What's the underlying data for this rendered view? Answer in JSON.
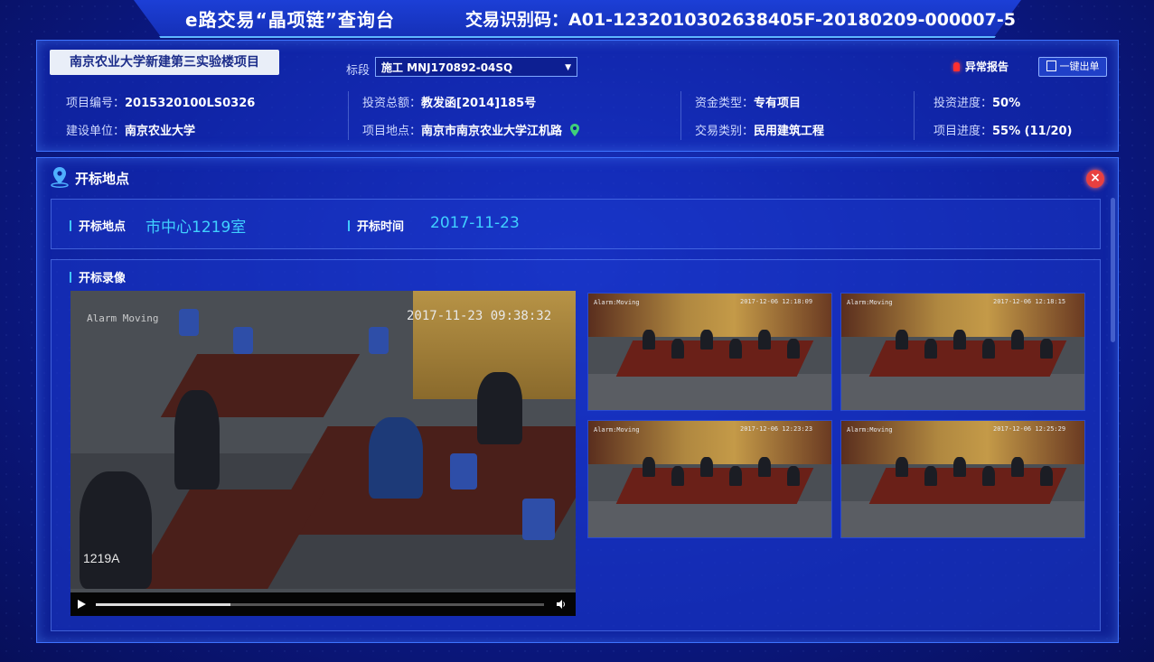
{
  "header": {
    "app_title": "e路交易“晶项链”查询台",
    "transaction_code_label": "交易识别码：",
    "transaction_code": "A01-1232010302638405F-20180209-000007-5"
  },
  "project": {
    "name": "南京农业大学新建第三实验楼项目",
    "section_label": "标段",
    "section_value": "施工 MNJ170892-04SQ",
    "alarm_label": "异常报告",
    "export_label": "一键出单",
    "fields": {
      "project_no_label": "项目编号：",
      "project_no": "2015320100LS0326",
      "investment_label": "投资总额：",
      "investment": "教发函[2014]185号",
      "fund_type_label": "资金类型：",
      "fund_type": "专有项目",
      "invest_progress_label": "投资进度：",
      "invest_progress": "50%",
      "builder_label": "建设单位：",
      "builder": "南京农业大学",
      "location_label": "项目地点：",
      "location": "南京市南京农业大学江机路",
      "trade_type_label": "交易类别：",
      "trade_type": "民用建筑工程",
      "project_progress_label": "项目进度：",
      "project_progress": "55% (11/20)"
    }
  },
  "bid_opening": {
    "section_title": "开标地点",
    "place_label": "开标地点",
    "place": "市中心1219室",
    "time_label": "开标时间",
    "time": "2017-11-23",
    "recording_label": "开标录像",
    "main_video": {
      "alarm_text": "Alarm Moving",
      "timestamp": "2017-11-23 09:38:32",
      "room_label": "1219A",
      "progress": 0.3
    },
    "thumbnails": [
      {
        "alarm_text": "Alarm:Moving",
        "timestamp": "2017-12-06 12:18:09"
      },
      {
        "alarm_text": "Alarm:Moving",
        "timestamp": "2017-12-06 12:18:15"
      },
      {
        "alarm_text": "Alarm:Moving",
        "timestamp": "2017-12-06 12:23:23"
      },
      {
        "alarm_text": "Alarm:Moving",
        "timestamp": "2017-12-06 12:25:29"
      }
    ]
  },
  "colors": {
    "accent": "#40d0ff",
    "panel_border": "#3e73ff",
    "alarm": "#ff3030",
    "close": "#e84040"
  }
}
